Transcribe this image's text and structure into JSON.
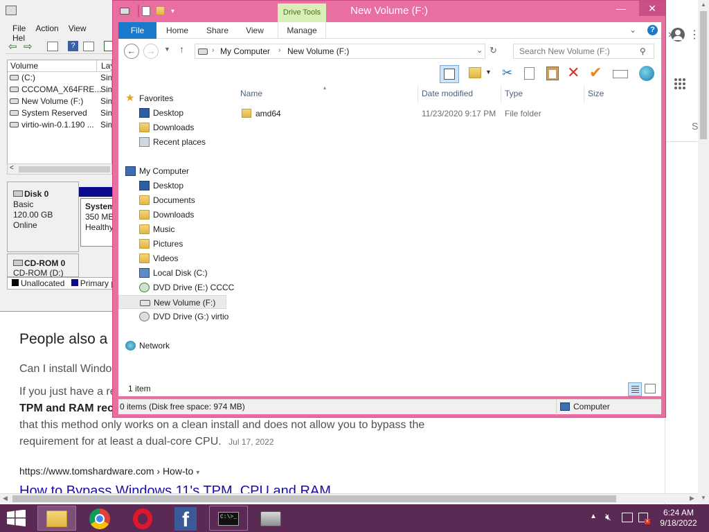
{
  "browser": {
    "people_also_ask": "People also a",
    "question": "Can I install Windo",
    "snippet_line1": "If you just have a re",
    "snippet_line2": "TPM and RAM rec",
    "snippet_line3": "that this method only works on a clean install and does not allow you to bypass the",
    "snippet_line4": "requirement for at least a dual-core CPU.",
    "snippet_date": "Jul 17, 2022",
    "result_url": "https://www.tomshardware.com › How-to",
    "result_title": "How to Bypass Windows 11's TPM, CPU and RAM",
    "right_char": "S"
  },
  "diskmgmt": {
    "menu": [
      "File",
      "Action",
      "View",
      "Hel"
    ],
    "columns": [
      "Volume",
      "Lay"
    ],
    "volumes": [
      {
        "name": "(C:)",
        "layout": "Sim"
      },
      {
        "name": "CCCOMA_X64FRE...",
        "layout": "Sim"
      },
      {
        "name": "New Volume (F:)",
        "layout": "Sim"
      },
      {
        "name": "System Reserved",
        "layout": "Sim"
      },
      {
        "name": "virtio-win-0.1.190 ...",
        "layout": "Sim"
      }
    ],
    "disk0": {
      "title": "Disk 0",
      "type": "Basic",
      "size": "120.00 GB",
      "status": "Online"
    },
    "partition": {
      "title": "System",
      "size": "350 MB",
      "status": "Healthy"
    },
    "cdrom": {
      "title": "CD-ROM 0",
      "sub": "CD-ROM (D:)"
    },
    "legend_unallocated": "Unallocated",
    "legend_primary": "Primary p"
  },
  "explorer": {
    "title": "New Volume (F:)",
    "context_tab": "Drive Tools",
    "tabs": [
      "File",
      "Home",
      "Share",
      "View",
      "Manage"
    ],
    "breadcrumb": [
      "My Computer",
      "New Volume (F:)"
    ],
    "search_placeholder": "Search New Volume (F:)",
    "nav": {
      "favorites": "Favorites",
      "fav_items": [
        "Desktop",
        "Downloads",
        "Recent places"
      ],
      "computer": "My Computer",
      "computer_items": [
        "Desktop",
        "Documents",
        "Downloads",
        "Music",
        "Pictures",
        "Videos",
        "Local Disk (C:)",
        "DVD Drive (E:) CCCC",
        "New Volume (F:)",
        "DVD Drive (G:) virtio"
      ],
      "network": "Network"
    },
    "columns": [
      "Name",
      "Date modified",
      "Type",
      "Size"
    ],
    "files": [
      {
        "name": "amd64",
        "date": "11/23/2020 9:17 PM",
        "type": "File folder",
        "size": ""
      }
    ],
    "item_count": "1 item",
    "status_left": "0 items (Disk free space: 974 MB)",
    "status_right": "Computer"
  },
  "taskbar": {
    "time": "6:24 AM",
    "date": "9/18/2022"
  }
}
